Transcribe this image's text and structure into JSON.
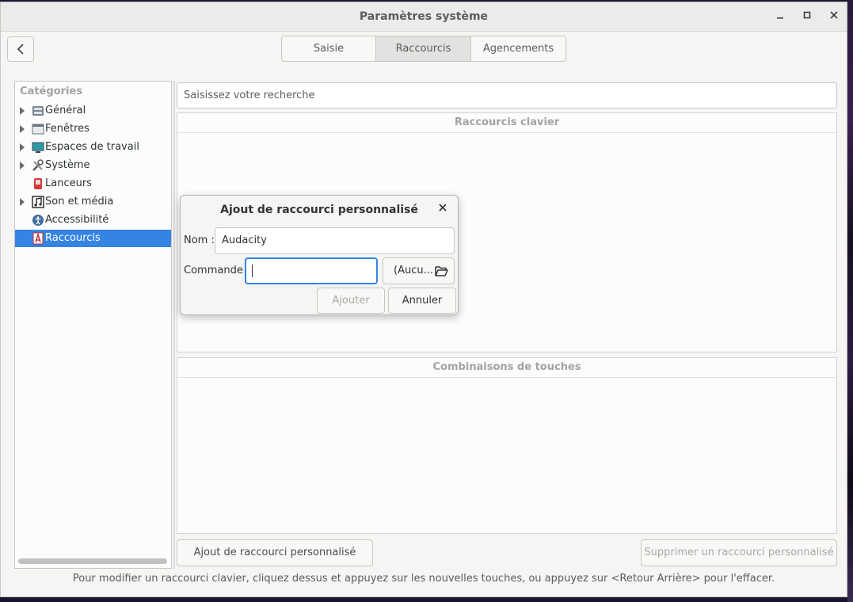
{
  "window": {
    "title": "Paramètres système",
    "controls": {
      "minimize": "–",
      "maximize": "□",
      "close": "✕"
    }
  },
  "tabs": [
    {
      "label": "Saisie",
      "active": false
    },
    {
      "label": "Raccourcis",
      "active": true
    },
    {
      "label": "Agencements",
      "active": false
    }
  ],
  "sidebar": {
    "title": "Catégories",
    "items": [
      {
        "label": "Général",
        "expandable": true,
        "icon": "general-icon"
      },
      {
        "label": "Fenêtres",
        "expandable": true,
        "icon": "windows-icon"
      },
      {
        "label": "Espaces de travail",
        "expandable": true,
        "icon": "workspaces-icon"
      },
      {
        "label": "Système",
        "expandable": true,
        "icon": "system-tools-icon"
      },
      {
        "label": "Lanceurs",
        "expandable": false,
        "icon": "launchers-icon"
      },
      {
        "label": "Son et média",
        "expandable": true,
        "icon": "sound-media-icon"
      },
      {
        "label": "Accessibilité",
        "expandable": false,
        "icon": "accessibility-icon"
      },
      {
        "label": "Raccourcis personnalisés",
        "expandable": false,
        "icon": "custom-shortcuts-icon",
        "selected": true
      }
    ]
  },
  "search": {
    "placeholder": "Saisissez votre recherche"
  },
  "panels": {
    "shortcuts_header": "Raccourcis clavier",
    "bindings_header": "Combinaisons de touches"
  },
  "buttons": {
    "add_custom": "Ajout de raccourci personnalisé",
    "remove_custom": "Supprimer un raccourci personnalisé"
  },
  "status_text": "Pour modifier un raccourci clavier, cliquez dessus et appuyez sur les nouvelles touches, ou appuyez sur <Retour Arrière> pour l'effacer.",
  "dialog": {
    "title": "Ajout de raccourci personnalisé",
    "close": "✕",
    "name_label": "Nom :",
    "name_value": "Audacity",
    "command_label": "Commande :",
    "command_value": "",
    "file_chooser_label": "(Aucu...",
    "add_button": "Ajouter",
    "cancel_button": "Annuler"
  },
  "colors": {
    "accent": "#3584e4"
  }
}
